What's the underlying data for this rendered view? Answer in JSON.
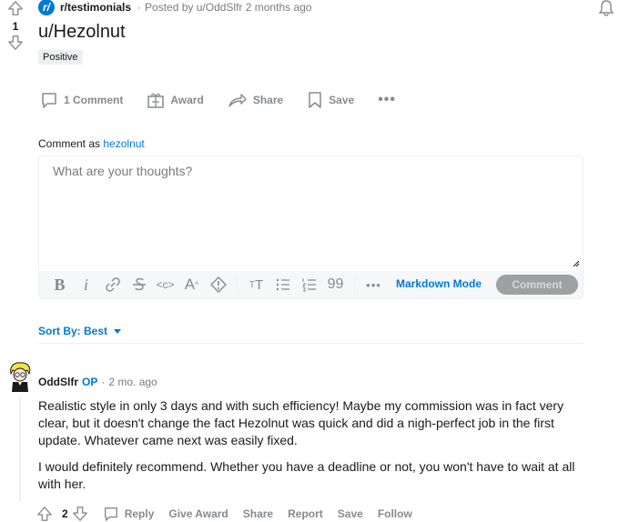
{
  "post": {
    "subreddit": "r/testimonials",
    "subreddit_icon": "r/",
    "posted_by": "Posted by u/OddSlfr 2 months ago",
    "score": "1",
    "title": "u/Hezolnut",
    "flair": "Positive"
  },
  "actions": {
    "comments": "1 Comment",
    "award": "Award",
    "share": "Share",
    "save": "Save",
    "more": "•••"
  },
  "composer": {
    "comment_as_label": "Comment as",
    "username": "hezolnut",
    "placeholder": "What are your thoughts?",
    "markdown_mode": "Markdown Mode",
    "submit": "Comment",
    "toolbar_more": "•••"
  },
  "sort": {
    "label": "Sort By: Best"
  },
  "comment": {
    "author": "OddSlfr",
    "op_badge": "OP",
    "separator": "·",
    "time": "2 mo. ago",
    "paragraphs": [
      "Realistic style in only 3 days and with such efficiency! Maybe my commission was in fact very clear, but it doesn't change the fact Hezolnut was quick and did a nigh-perfect job in the first update. Whatever came next was easily fixed.",
      "I would definitely recommend. Whether you have a deadline or not, you won't have to wait at all with her."
    ],
    "score": "2",
    "reply": "Reply",
    "give_award": "Give Award",
    "share": "Share",
    "report": "Report",
    "save": "Save",
    "follow": "Follow"
  },
  "colors": {
    "accent": "#0079d3",
    "muted": "#878a8c",
    "button_disabled": "#9ea0a2"
  }
}
